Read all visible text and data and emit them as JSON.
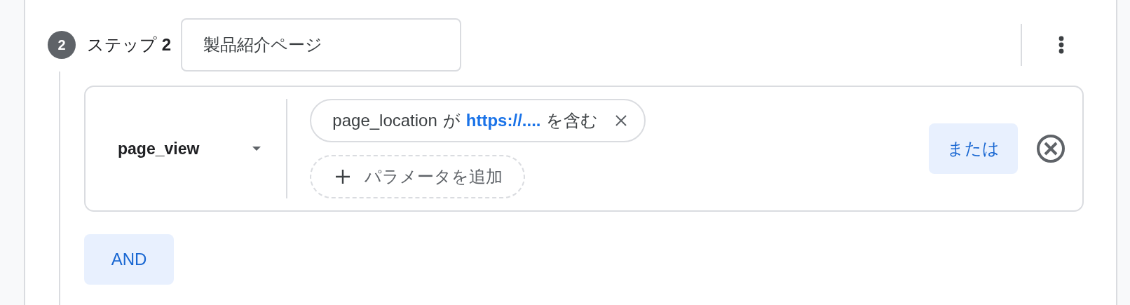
{
  "step": {
    "number": "2",
    "title": "ステップ **2**",
    "name_field": {
      "value": "製品紹介ページ"
    }
  },
  "condition": {
    "event": "page_view",
    "filter": {
      "parameter": "page_location",
      "operator": "が",
      "value": "https://....",
      "match": "を含む"
    },
    "add_parameter": "パラメータを追加",
    "or_button": "または"
  },
  "and_button": "AND"
}
